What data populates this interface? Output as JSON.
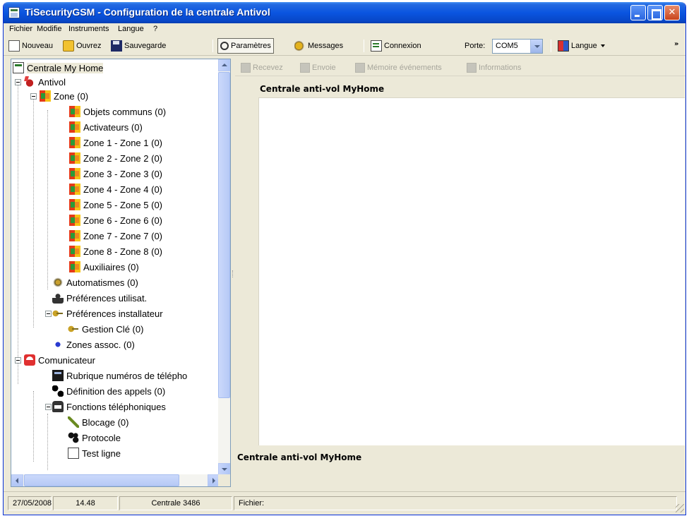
{
  "window": {
    "title": "TiSecurityGSM - Configuration de la centrale Antivol",
    "min_glyph": "",
    "close_glyph": "✕"
  },
  "menu": [
    "Fichier",
    "Modifie",
    "Instruments",
    "Langue",
    "?"
  ],
  "toolbar": {
    "new": "Nouveau",
    "open": "Ouvrez",
    "save": "Sauvegarde",
    "params": "Paramètres",
    "messages": "Messages",
    "connect": "Connexion",
    "port_label": "Porte:",
    "port_value": "COM5",
    "language": "Langue",
    "overflow": "»"
  },
  "tree": {
    "root": "Centrale My Home",
    "antivol": "Antivol",
    "zone": "Zone (0)",
    "zone_children": [
      "Objets communs (0)",
      "Activateurs (0)",
      "Zone 1 - Zone 1 (0)",
      "Zone 2 - Zone 2 (0)",
      "Zone 3 - Zone 3 (0)",
      "Zone 4 - Zone 4 (0)",
      "Zone 5 - Zone 5 (0)",
      "Zone 6 - Zone 6 (0)",
      "Zone 7 - Zone 7 (0)",
      "Zone 8 - Zone 8 (0)",
      "Auxiliaires (0)"
    ],
    "automatismes": "Automatismes (0)",
    "pref_user": "Préférences utilisat.",
    "pref_install": "Préférences installateur",
    "gestion_cle": "Gestion Clé (0)",
    "zones_assoc": "Zones assoc. (0)",
    "comunicateur": "Comunicateur",
    "rubrique": "Rubrique numéros de télépho",
    "definition": "Définition des appels (0)",
    "fonctions": "Fonctions téléphoniques",
    "blocage": "Blocage (0)",
    "protocole": "Protocole",
    "test_ligne": "Test ligne"
  },
  "right_toolbar": {
    "receive": "Recevez",
    "send": "Envoie",
    "events": "Mémoire événements",
    "info": "Informations"
  },
  "content": {
    "header": "Centrale anti-vol MyHome",
    "footer": "Centrale anti-vol MyHome"
  },
  "status": {
    "date": "27/05/2008",
    "time": "14.48",
    "central": "Centrale 3486",
    "file": "Fichier:"
  }
}
